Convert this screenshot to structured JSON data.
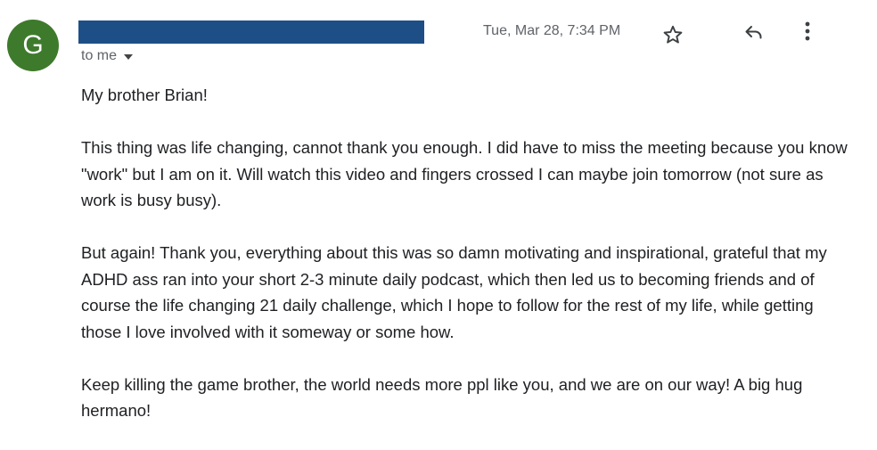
{
  "header": {
    "avatar_letter": "G",
    "recipient_label": "to me",
    "timestamp": "Tue, Mar 28, 7:34 PM",
    "colors": {
      "avatar_bg": "#3e7a2c",
      "redaction_bar": "#1d4f86"
    },
    "icons": [
      "star-icon",
      "reply-icon",
      "more-vert-icon",
      "chevron-down-icon"
    ]
  },
  "body": {
    "greeting": "My brother Brian!",
    "paragraphs": [
      "This thing was life changing, cannot thank you enough. I did have to miss the meeting because you know \"work\" but I am on it. Will watch this video and fingers crossed I can maybe join tomorrow (not sure as work is busy busy).",
      "But again! Thank you, everything about this was so damn motivating and inspirational, grateful that my ADHD ass ran into your short 2-3 minute daily podcast, which then led us to becoming friends and of course the life changing 21 daily challenge, which I hope to follow for the rest of my life, while getting those I love involved with it someway or some how.",
      "Keep killing the game brother, the world needs more ppl like you, and we are on our way! A big hug hermano!"
    ]
  }
}
